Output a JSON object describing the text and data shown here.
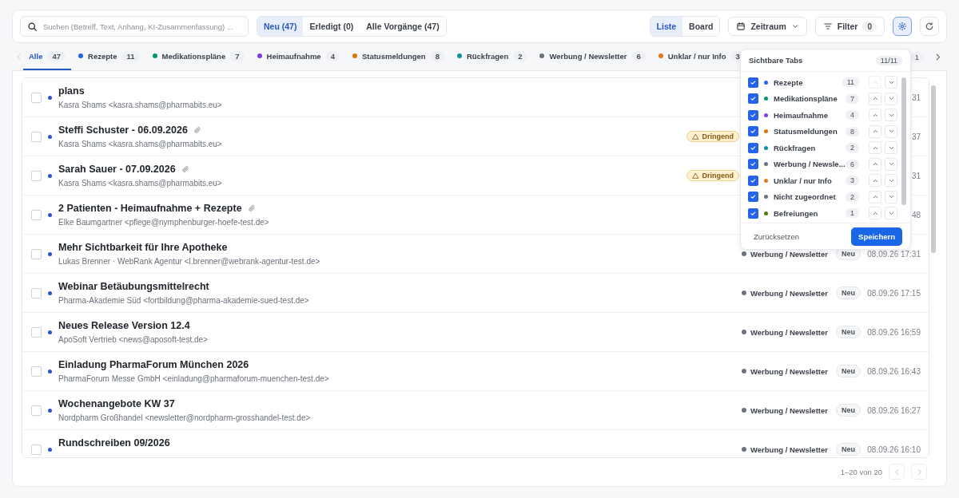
{
  "toolbar": {
    "search": {
      "placeholder": "Suchen (Betreff, Text, Anhang, KI-Zusammenfassung) ..."
    },
    "status_filter": [
      {
        "label": "Neu (47)",
        "selected": true
      },
      {
        "label": "Erledigt (0)",
        "selected": false
      },
      {
        "label": "Alle Vorgänge (47)",
        "selected": false
      }
    ],
    "view_toggle": [
      {
        "label": "Liste",
        "selected": true
      },
      {
        "label": "Board",
        "selected": false
      }
    ],
    "period_button": "Zeitraum",
    "filter_button": {
      "label": "Filter",
      "count": "0"
    },
    "tab_settings_active": true
  },
  "tabs": [
    {
      "label": "Alle",
      "count": "47",
      "selected": true
    },
    {
      "label": "Rezepte",
      "count": "11",
      "color": "#2563eb",
      "selected": false
    },
    {
      "label": "Medikationspläne",
      "count": "7",
      "color": "#059669",
      "selected": false
    },
    {
      "label": "Heimaufnahme",
      "count": "4",
      "color": "#7c3aed",
      "selected": false
    },
    {
      "label": "Statusmeldungen",
      "count": "8",
      "color": "#d97706",
      "selected": false
    },
    {
      "label": "Rückfragen",
      "count": "2",
      "color": "#0e8fa3",
      "selected": false
    },
    {
      "label": "Werbung / Newsletter",
      "count": "6",
      "color": "#6b7280",
      "selected": false
    },
    {
      "label": "Unklar / nur Info",
      "count": "3",
      "color": "#e07a1f",
      "selected": false
    }
  ],
  "tabs_overflow_count": "1",
  "rows": [
    {
      "title": "plans",
      "sender": "Kasra Shams <kasra.shams@pharmabits.eu>",
      "unread": true,
      "checked": false,
      "attachment": false,
      "time": "31"
    },
    {
      "title": "Steffi Schuster - 06.09.2026",
      "sender": "Kasra Shams <kasra.shams@pharmabits.eu>",
      "unread": true,
      "checked": false,
      "attachment": true,
      "badge": "Dringend",
      "time": "37"
    },
    {
      "title": "Sarah Sauer - 07.09.2026",
      "sender": "Kasra Shams <kasra.shams@pharmabits.eu>",
      "unread": true,
      "checked": false,
      "attachment": true,
      "badge": "Dringend",
      "time": "31"
    },
    {
      "title": "2 Patienten - Heimaufnahme + Rezepte",
      "sender": "Elke Baumgartner <pflege@nymphenburger-hoefe-test.de>",
      "unread": true,
      "checked": false,
      "attachment": true,
      "time": "48"
    },
    {
      "title": "Mehr Sichtbarkeit für Ihre Apotheke",
      "sender": "Lukas Brenner · WebRank Agentur <l.brenner@webrank-agentur-test.de>",
      "unread": true,
      "checked": false,
      "attachment": false,
      "category": "Werbung / Newsletter",
      "status": "Neu",
      "time": "08.09.26 17:31"
    },
    {
      "title": "Webinar Betäubungsmittelrecht",
      "sender": "Pharma-Akademie Süd <fortbildung@pharma-akademie-sued-test.de>",
      "unread": true,
      "checked": false,
      "attachment": false,
      "category": "Werbung / Newsletter",
      "status": "Neu",
      "time": "08.09.26 17:15"
    },
    {
      "title": "Neues Release Version 12.4",
      "sender": "ApoSoft Vertrieb <news@aposoft-test.de>",
      "unread": true,
      "checked": false,
      "attachment": false,
      "category": "Werbung / Newsletter",
      "status": "Neu",
      "time": "08.09.26 16:59"
    },
    {
      "title": "Einladung PharmaForum München 2026",
      "sender": "PharmaForum Messe GmbH <einladung@pharmaforum-muenchen-test.de>",
      "unread": true,
      "checked": false,
      "attachment": false,
      "category": "Werbung / Newsletter",
      "status": "Neu",
      "time": "08.09.26 16:43"
    },
    {
      "title": "Wochenangebote KW 37",
      "sender": "Nordpharm Großhandel <newsletter@nordpharm-grosshandel-test.de>",
      "unread": true,
      "checked": false,
      "attachment": false,
      "category": "Werbung / Newsletter",
      "status": "Neu",
      "time": "08.09.26 16:27"
    },
    {
      "title": "Rundschreiben 09/2026",
      "unread": true,
      "checked": false,
      "attachment": false,
      "category": "Werbung / Newsletter",
      "status": "Neu",
      "time": "08.09.26 16:10"
    }
  ],
  "pagination": {
    "range": "1–20 von 20"
  },
  "tab_popover": {
    "title": "Sichtbare Tabs",
    "count": "11/11",
    "reset_button": "Zurücksetzen",
    "save_button": "Speichern",
    "items": [
      {
        "label": "Rezepte",
        "count": "11",
        "color": "#2563eb",
        "checked": true,
        "up_disabled": true
      },
      {
        "label": "Medikationspläne",
        "count": "7",
        "color": "#059669",
        "checked": true,
        "up_disabled": false
      },
      {
        "label": "Heimaufnahme",
        "count": "4",
        "color": "#7c3aed",
        "checked": true,
        "up_disabled": false
      },
      {
        "label": "Statusmeldungen",
        "count": "8",
        "color": "#d97706",
        "checked": true,
        "up_disabled": false
      },
      {
        "label": "Rückfragen",
        "count": "2",
        "color": "#0e8fa3",
        "checked": true,
        "up_disabled": false
      },
      {
        "label": "Werbung / Newsle...",
        "count": "6",
        "color": "#6b7280",
        "checked": true,
        "up_disabled": false
      },
      {
        "label": "Unklar / nur Info",
        "count": "3",
        "color": "#e07a1f",
        "checked": true,
        "up_disabled": false
      },
      {
        "label": "Nicht zugeordnet",
        "count": "2",
        "color": "#6b7280",
        "checked": true,
        "up_disabled": false
      },
      {
        "label": "Befreiungen",
        "count": "1",
        "color": "#4d7c0f",
        "checked": true,
        "up_disabled": false
      }
    ]
  }
}
